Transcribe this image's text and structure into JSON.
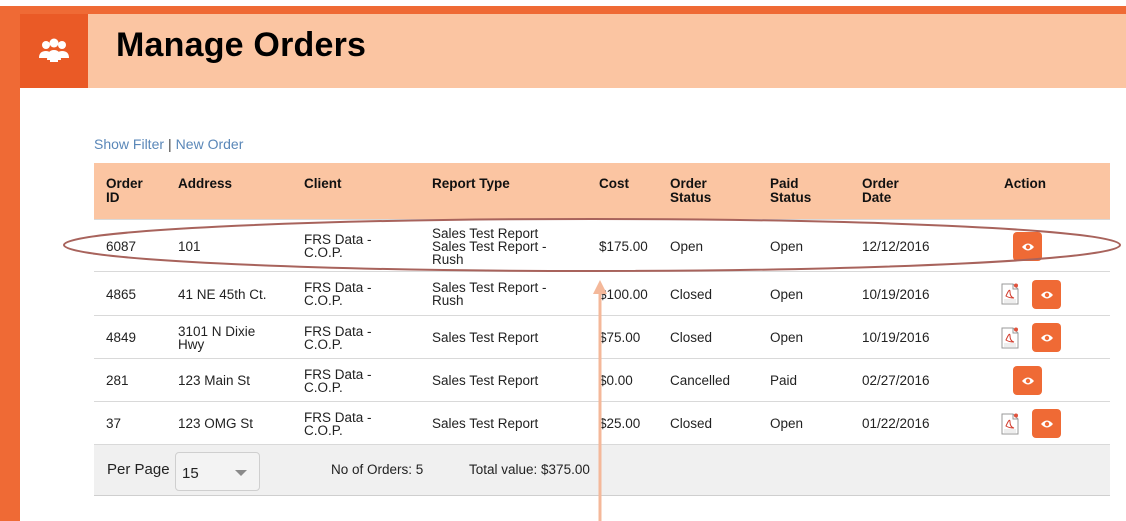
{
  "header": {
    "title": "Manage Orders",
    "icon": "users-group-icon",
    "colors": {
      "accent": "#ef6a35",
      "header_band": "#fbc5a2",
      "icon_box": "#ea5a26"
    }
  },
  "links": {
    "show_filter": "Show Filter",
    "separator": "|",
    "new_order": "New Order"
  },
  "table": {
    "headers": {
      "order_id": [
        "Order",
        "ID"
      ],
      "address": "Address",
      "client": "Client",
      "report_type": "Report Type",
      "cost": "Cost",
      "order_status": [
        "Order",
        "Status"
      ],
      "paid_status": [
        "Paid",
        "Status"
      ],
      "order_date": [
        "Order",
        "Date"
      ],
      "action": "Action"
    },
    "rows": [
      {
        "order_id": "6087",
        "address": [
          "101"
        ],
        "client": [
          "FRS Data -",
          "C.O.P."
        ],
        "report_type": [
          "Sales Test Report",
          "Sales Test Report -",
          "Rush"
        ],
        "cost": "$175.00",
        "order_status": "Open",
        "paid_status": "Open",
        "order_date": "12/12/2016",
        "has_pdf": false
      },
      {
        "order_id": "4865",
        "address": [
          "41 NE 45th Ct."
        ],
        "client": [
          "FRS Data -",
          "C.O.P."
        ],
        "report_type": [
          "Sales Test Report -",
          "Rush"
        ],
        "cost": "$100.00",
        "order_status": "Closed",
        "paid_status": "Open",
        "order_date": "10/19/2016",
        "has_pdf": true
      },
      {
        "order_id": "4849",
        "address": [
          "3101 N Dixie",
          "Hwy"
        ],
        "client": [
          "FRS Data -",
          "C.O.P."
        ],
        "report_type": [
          "Sales Test Report"
        ],
        "cost": "$75.00",
        "order_status": "Closed",
        "paid_status": "Open",
        "order_date": "10/19/2016",
        "has_pdf": true
      },
      {
        "order_id": "281",
        "address": [
          "123 Main St"
        ],
        "client": [
          "FRS Data -",
          "C.O.P."
        ],
        "report_type": [
          "Sales Test Report"
        ],
        "cost": "$0.00",
        "order_status": "Cancelled",
        "paid_status": "Paid",
        "order_date": "02/27/2016",
        "has_pdf": false
      },
      {
        "order_id": "37",
        "address": [
          "123 OMG St"
        ],
        "client": [
          "FRS Data -",
          "C.O.P."
        ],
        "report_type": [
          "Sales Test Report"
        ],
        "cost": "$25.00",
        "order_status": "Closed",
        "paid_status": "Open",
        "order_date": "01/22/2016",
        "has_pdf": true
      }
    ],
    "action_icons": {
      "view": "eye-icon",
      "pdf": "pdf-icon"
    }
  },
  "footer": {
    "per_page_label": "Per Page",
    "per_page_value": "15",
    "orders_count": "No of Orders: 5",
    "total_value": "Total value: $375.00"
  },
  "annotation": {
    "color": "#a8635c",
    "arrow_color": "#f4b89a"
  }
}
